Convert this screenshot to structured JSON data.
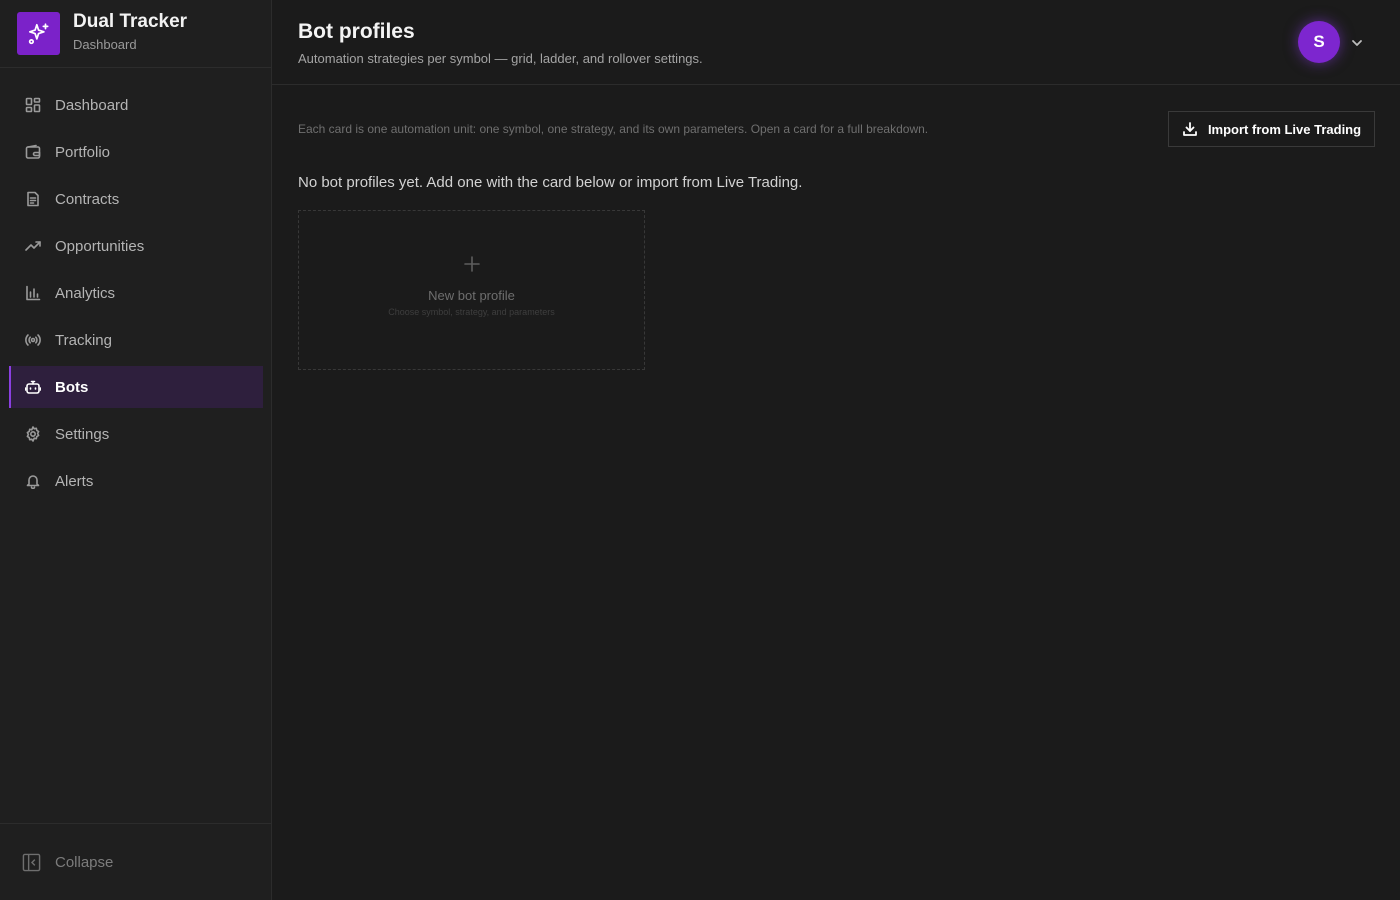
{
  "brand": {
    "title": "Dual Tracker",
    "subtitle": "Dashboard",
    "icon": "sparkles-icon",
    "color": "#7b22c9"
  },
  "sidebar": {
    "items": [
      {
        "label": "Dashboard",
        "icon": "grid-icon",
        "active": false
      },
      {
        "label": "Portfolio",
        "icon": "wallet-icon",
        "active": false
      },
      {
        "label": "Contracts",
        "icon": "document-icon",
        "active": false
      },
      {
        "label": "Opportunities",
        "icon": "trending-up-icon",
        "active": false
      },
      {
        "label": "Analytics",
        "icon": "bar-chart-icon",
        "active": false
      },
      {
        "label": "Tracking",
        "icon": "radio-signal-icon",
        "active": false
      },
      {
        "label": "Bots",
        "icon": "bot-icon",
        "active": true
      },
      {
        "label": "Settings",
        "icon": "gear-icon",
        "active": false
      },
      {
        "label": "Alerts",
        "icon": "bell-icon",
        "active": false
      }
    ],
    "collapse_label": "Collapse",
    "active_accent": "#8a3fe0"
  },
  "header": {
    "title": "Bot profiles",
    "subtitle": "Automation strategies per symbol — grid, ladder, and rollover settings.",
    "avatar_initial": "S"
  },
  "main": {
    "description": "Each card is one automation unit: one symbol, one strategy, and its own parameters. Open a card for a full breakdown.",
    "import_button": "Import from Live Trading",
    "empty_message": "No bot profiles yet. Add one with the card below or import from Live Trading.",
    "new_card": {
      "title": "New bot profile",
      "hint": "Choose symbol, strategy, and parameters"
    }
  }
}
